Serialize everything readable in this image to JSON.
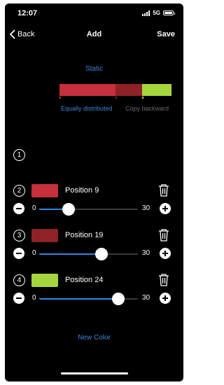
{
  "status": {
    "time": "12:07",
    "network": "5G"
  },
  "nav": {
    "back_label": "Back",
    "title": "Add",
    "save_label": "Save"
  },
  "mode_label": "Static",
  "preview": {
    "segments": [
      {
        "color": "#c6303a",
        "fraction": 0.5
      },
      {
        "color": "#8e2226",
        "fraction": 0.24
      },
      {
        "color": "#a6d63d",
        "fraction": 0.26
      }
    ]
  },
  "actions": {
    "distribute_label": "Equally distributed",
    "copy_label": "Copy backward"
  },
  "slot1": {
    "index": "1"
  },
  "colors": [
    {
      "index": "2",
      "color": "#c6303a",
      "label": "Position 9",
      "min": "0",
      "max": "30",
      "value": 9
    },
    {
      "index": "3",
      "color": "#8e2226",
      "label": "Position 19",
      "min": "0",
      "max": "30",
      "value": 19
    },
    {
      "index": "4",
      "color": "#a6d63d",
      "label": "Position 24",
      "min": "0",
      "max": "30",
      "value": 24
    }
  ],
  "new_color_label": "New Color"
}
